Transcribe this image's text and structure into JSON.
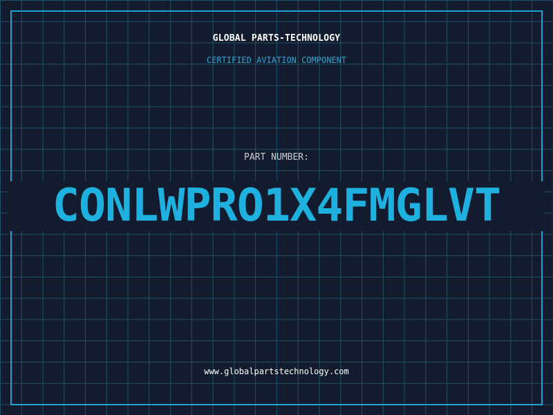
{
  "brand": {
    "title": "GLOBAL PARTS-TECHNOLOGY",
    "subtitle": "CERTIFIED AVIATION COMPONENT"
  },
  "part": {
    "label": "PART NUMBER:",
    "number": "CONLWPRO1X4FMGLVT"
  },
  "footer": {
    "website": "www.globalpartstechnology.com"
  },
  "colors": {
    "background": "#131c2e",
    "grid": "#1f5267",
    "accent": "#1eb0de",
    "text": "#ffffff",
    "muted": "#c9cdd6"
  }
}
